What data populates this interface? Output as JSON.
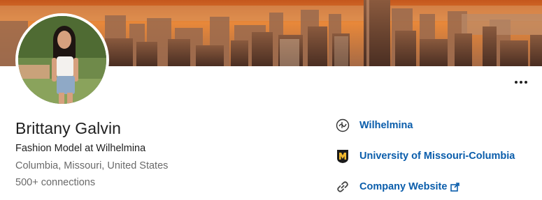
{
  "profile": {
    "name": "Brittany Galvin",
    "headline": "Fashion Model at Wilhelmina",
    "location": "Columbia, Missouri, United States",
    "connections": "500+ connections"
  },
  "side_links": [
    {
      "label": "Wilhelmina",
      "icon": "company-logo-icon"
    },
    {
      "label": "University of Missouri-Columbia",
      "icon": "school-logo-icon"
    },
    {
      "label": "Company Website",
      "icon": "link-icon",
      "external": true
    }
  ],
  "more_button": {
    "icon": "ellipsis-icon"
  },
  "colors": {
    "link": "#0a5dab",
    "text": "#1f1f1f",
    "muted": "#6a6a6a",
    "banner_sky": "#e07a2e",
    "mizzou_gold": "#f1b82d"
  }
}
